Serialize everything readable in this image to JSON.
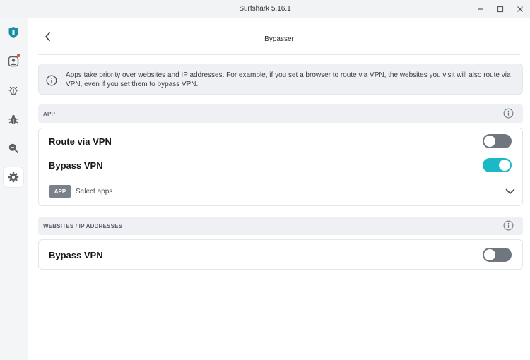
{
  "window": {
    "title": "Surfshark 5.16.1"
  },
  "header": {
    "title": "Bypasser"
  },
  "info": {
    "text": "Apps take priority over websites and IP addresses. For example, if you set a browser to route via VPN, the websites you visit will also route via VPN, even if you set them to bypass VPN."
  },
  "app_section": {
    "label": "APP",
    "route_via_vpn": {
      "label": "Route via VPN",
      "enabled": false
    },
    "bypass_vpn": {
      "label": "Bypass VPN",
      "enabled": true
    },
    "app_badge": "APP",
    "select_apps": "Select apps"
  },
  "websites_section": {
    "label": "WEBSITES / IP ADDRESSES",
    "bypass_vpn": {
      "label": "Bypass VPN",
      "enabled": false
    }
  },
  "sidebar": {
    "items": [
      {
        "icon": "surfshark-shield-icon",
        "active": false
      },
      {
        "icon": "account-icon",
        "active": false,
        "notification": true
      },
      {
        "icon": "alert-bug-icon",
        "active": false
      },
      {
        "icon": "antivirus-icon",
        "active": false
      },
      {
        "icon": "search-privacy-icon",
        "active": false
      },
      {
        "icon": "settings-gear-icon",
        "active": true
      }
    ]
  },
  "colors": {
    "accent": "#1bb8c7",
    "toggle_off": "#6f767e",
    "brand": "#178fa3",
    "notification": "#ef4a4a"
  }
}
